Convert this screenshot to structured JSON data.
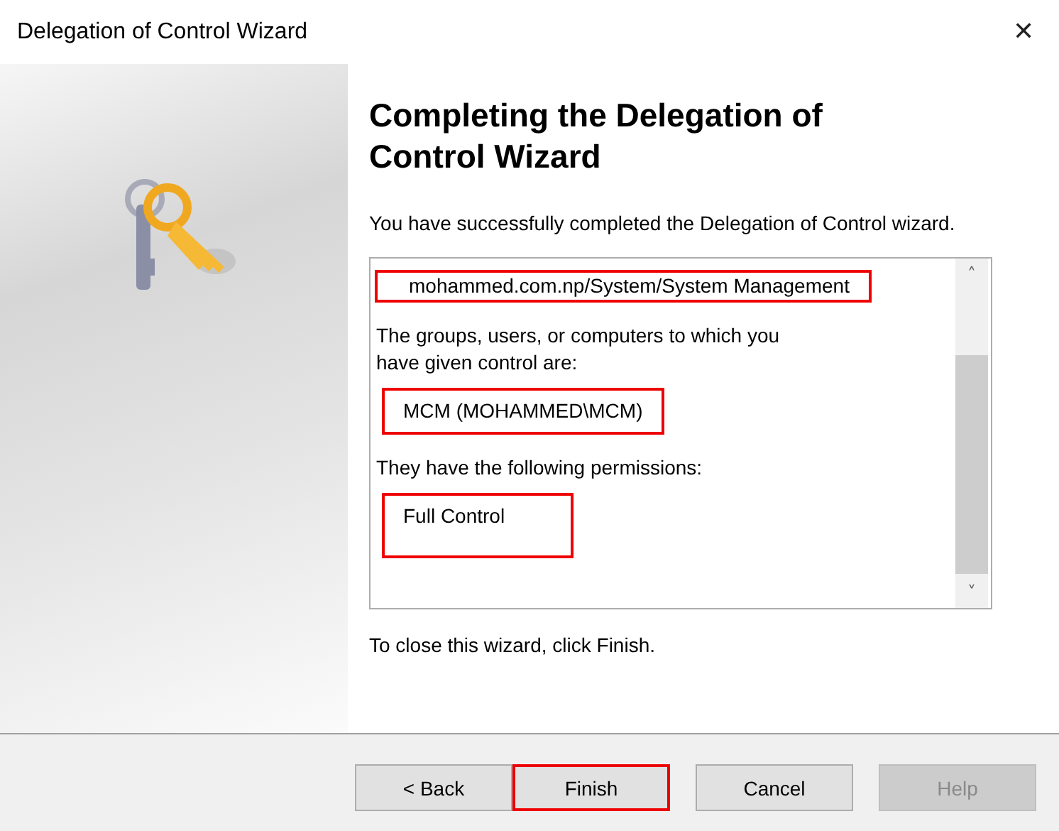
{
  "window": {
    "title": "Delegation of Control Wizard",
    "close": "✕"
  },
  "heading": "Completing the Delegation of Control Wizard",
  "intro": "You have successfully completed the Delegation of Control wizard.",
  "summary": [
    {
      "kind": "value",
      "text": "mohammed.com.np/System/System Management",
      "highlighted": true
    },
    {
      "kind": "text",
      "text": "The groups, users, or computers to which you\nhave given control are:",
      "highlighted": false
    },
    {
      "kind": "value",
      "text": "MCM (MOHAMMED\\MCM)",
      "highlighted": true
    },
    {
      "kind": "text",
      "text": "They have the following permissions:",
      "highlighted": false
    },
    {
      "kind": "value",
      "text": "Full Control",
      "highlighted": true
    }
  ],
  "scroll": {
    "up": "˄",
    "down": "˅"
  },
  "footer_note": "To close this wizard, click Finish.",
  "buttons": [
    {
      "label": "< Back",
      "disabled": false,
      "default": false,
      "highlighted": false
    },
    {
      "label": "Finish",
      "disabled": false,
      "default": true,
      "highlighted": true
    },
    {
      "label": "Cancel",
      "disabled": false,
      "default": false,
      "highlighted": false
    },
    {
      "label": "Help",
      "disabled": true,
      "default": false,
      "highlighted": false
    }
  ]
}
